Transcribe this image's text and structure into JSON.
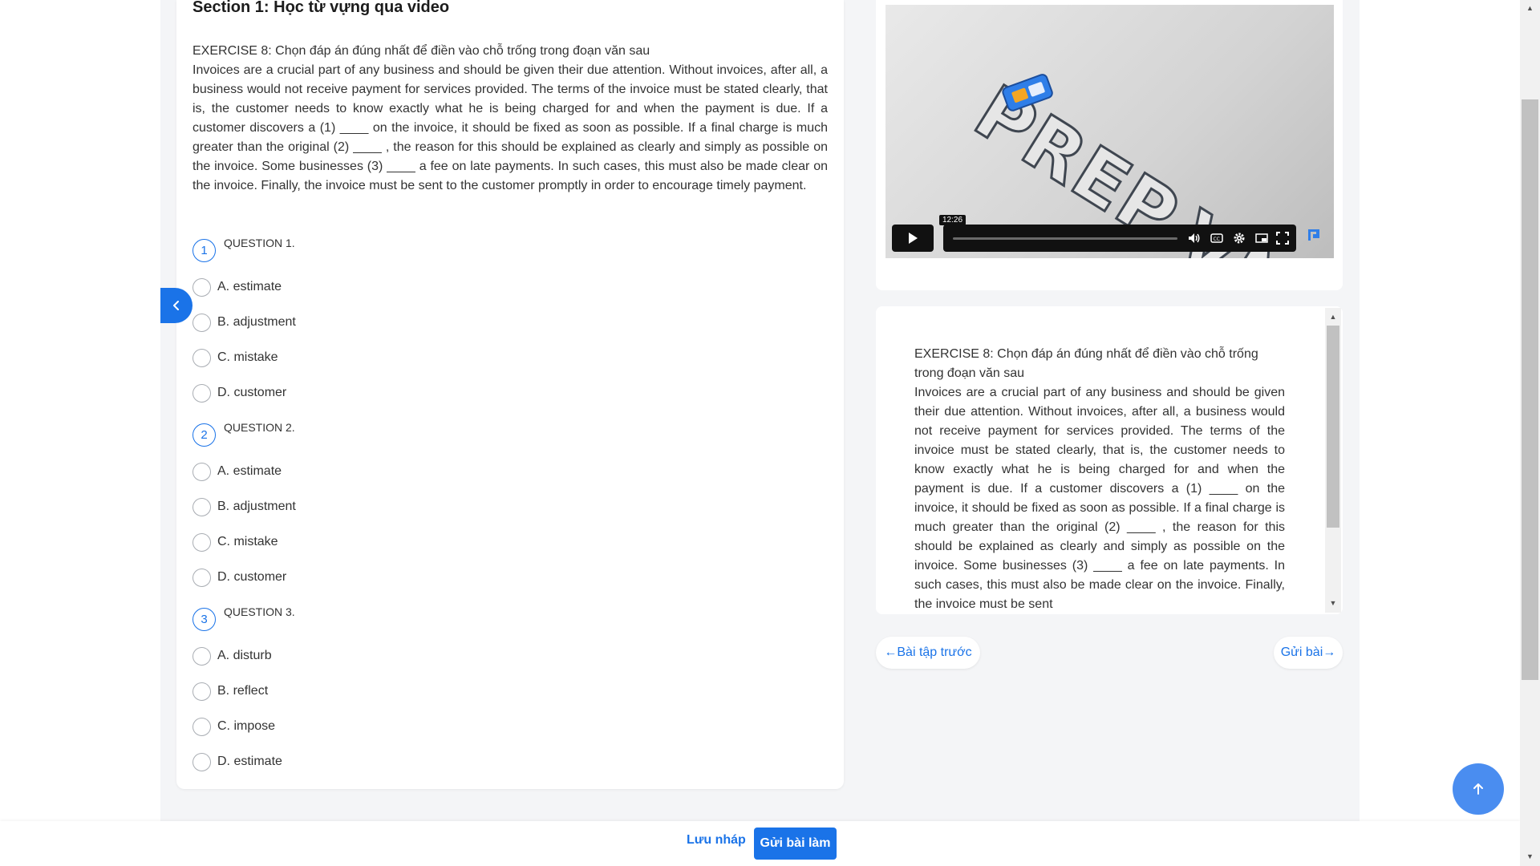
{
  "section_title": "Section 1: Học từ vựng qua video",
  "exercise": {
    "heading": "EXERCISE 8: Chọn đáp án đúng nhất để điền vào chỗ trống trong đoạn văn sau",
    "passage": "Invoices are a crucial part of any business and should be given their due attention. Without invoices, after all, a business would not receive payment for services provided. The terms of the invoice must be stated clearly, that is, the customer needs to know exactly what he is being charged for and when the payment is due. If a customer discovers a (1) ____ on the invoice, it should be fixed as soon as possible. If a final charge is much greater than the original (2) ____ , the reason for this should be explained as clearly and simply as possible on the invoice. Some businesses (3) ____ a fee on late payments. In such cases, this must also be made clear on the invoice. Finally, the invoice must be sent to the customer promptly in order to encourage timely payment."
  },
  "questions": [
    {
      "number": "1",
      "label": "QUESTION 1.",
      "options": [
        "A. estimate",
        "B. adjustment",
        "C. mistake",
        "D. customer"
      ]
    },
    {
      "number": "2",
      "label": "QUESTION 2.",
      "options": [
        "A. estimate",
        "B. adjustment",
        "C. mistake",
        "D. customer"
      ]
    },
    {
      "number": "3",
      "label": "QUESTION 3.",
      "options": [
        "A. disturb",
        "B. reflect",
        "C. impose",
        "D. estimate"
      ]
    }
  ],
  "video": {
    "logo_text": "PREP.VN",
    "time_tooltip": "12:26",
    "icons": [
      "play-icon",
      "volume-icon",
      "captions-icon",
      "settings-icon",
      "pip-icon",
      "fullscreen-icon"
    ]
  },
  "right_passage": {
    "heading": "EXERCISE 8: Chọn đáp án đúng nhất để điền vào chỗ trống trong đoạn văn sau",
    "text": "Invoices are a crucial part of any business and should be given their due attention. Without invoices, after all, a business would not receive payment for services provided. The terms of the invoice must be stated clearly, that is, the customer needs to know exactly what he is being charged for and when the payment is due. If a customer discovers a (1) ____ on the invoice, it should be fixed as soon as possible. If a final charge is much greater than the original (2) ____ , the reason for this should be explained as clearly and simply as possible on the invoice. Some businesses (3) ____ a fee on late payments. In such cases, this must also be made clear on the invoice. Finally, the invoice must be sent"
  },
  "nav": {
    "prev_label": "←Bài tập trước",
    "next_label": "Gửi bài→"
  },
  "bottom": {
    "save_draft": "Lưu nháp",
    "submit": "Gửi bài làm"
  },
  "colors": {
    "accent": "#1a73e8",
    "to_top": "#4a8df0"
  }
}
